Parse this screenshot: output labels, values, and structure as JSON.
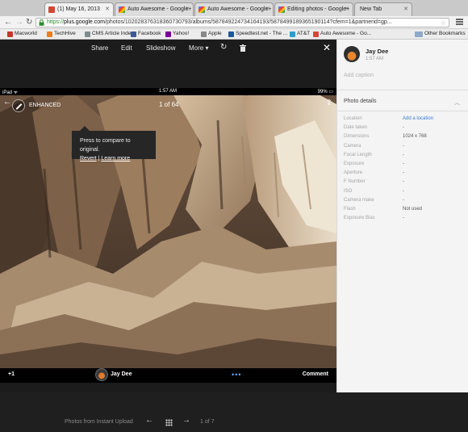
{
  "tabs": [
    {
      "title": "(1) May 16, 2013",
      "active": true,
      "favicon": "gplus-icon"
    },
    {
      "title": "Auto Awesome - Google+",
      "active": false,
      "favicon": "photos-icon"
    },
    {
      "title": "Auto Awesome - Google+",
      "active": false,
      "favicon": "photos-icon"
    },
    {
      "title": "Editing photos - Google+",
      "active": false,
      "favicon": "photos-icon"
    },
    {
      "title": "New Tab",
      "active": false,
      "favicon": ""
    }
  ],
  "address": {
    "scheme": "https://",
    "host": "plus.google.com",
    "path": "/photos/102028376318360730793/albums/5878492247341641​93/5878499189365190114?cfem=1&partnerid=gp..."
  },
  "bookmarks": [
    {
      "label": "Macworld",
      "color": "#c0392b"
    },
    {
      "label": "TechHive",
      "color": "#e67e22"
    },
    {
      "label": "CMS Article Index",
      "color": "#7f8c8d"
    },
    {
      "label": "Facebook",
      "color": "#3b5998"
    },
    {
      "label": "Yahoo!",
      "color": "#7b0099"
    },
    {
      "label": "Apple",
      "color": "#888888"
    },
    {
      "label": "Speedtest.net - The ...",
      "color": "#1e5799"
    },
    {
      "label": "AT&T",
      "color": "#2d9bd2"
    },
    {
      "label": "Auto Awesome - Go...",
      "color": "#d14836"
    }
  ],
  "other_bookmarks": "Other Bookmarks",
  "viewer": {
    "actions": {
      "share": "Share",
      "edit": "Edit",
      "slideshow": "Slideshow",
      "more": "More ▾"
    },
    "ios": {
      "device": "iPad ᯤ",
      "time": "1:57 AM",
      "battery": "99% ▭"
    },
    "enhanced_label": "ENHANCED",
    "counter": "1 of 64",
    "tooltip": {
      "line1": "Press to compare to original.",
      "revert": "Revert",
      "sep": " | ",
      "learn": "Learn more"
    },
    "bottom": {
      "plus_one": "+1",
      "owner": "Jay Dee",
      "more": "•••",
      "comment": "Comment"
    },
    "filmstrip": {
      "album": "Photos from Instant Upload",
      "position": "1 of 7"
    }
  },
  "panel": {
    "owner": "Jay Dee",
    "time": "1:57 AM",
    "caption_placeholder": "Add caption",
    "details_title": "Photo details",
    "details": [
      {
        "key": "Location",
        "value": "Add a location",
        "link": true
      },
      {
        "key": "Date taken",
        "value": "-",
        "link": false
      },
      {
        "key": "Dimensions",
        "value": "1024 x 768",
        "link": false
      },
      {
        "key": "Camera",
        "value": "-",
        "link": false
      },
      {
        "key": "Focal Length",
        "value": "-",
        "link": false
      },
      {
        "key": "Exposure",
        "value": "-",
        "link": false
      },
      {
        "key": "Aperture",
        "value": "-",
        "link": false
      },
      {
        "key": "F Number",
        "value": "-",
        "link": false
      },
      {
        "key": "ISO",
        "value": "-",
        "link": false
      },
      {
        "key": "Camera make",
        "value": "-",
        "link": false
      },
      {
        "key": "Flash",
        "value": "Not used",
        "link": false
      },
      {
        "key": "Exposure Bias",
        "value": "-",
        "link": false
      }
    ]
  }
}
